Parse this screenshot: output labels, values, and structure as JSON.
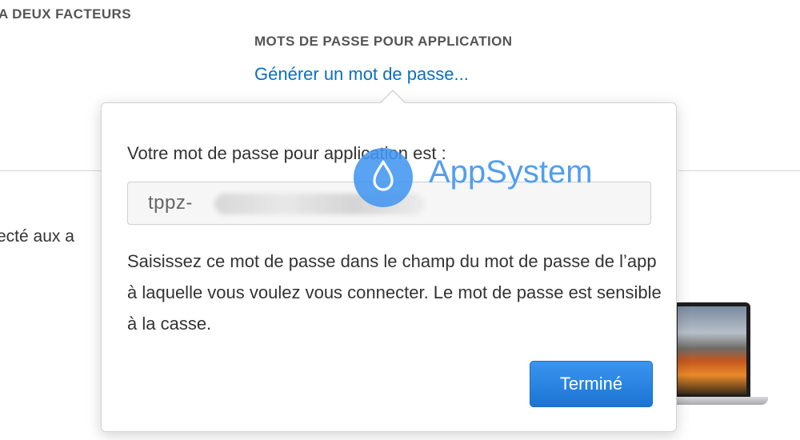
{
  "header": {
    "two_factor_title": "A DEUX FACTEURS",
    "app_passwords_title": "MOTS DE PASSE POUR APPLICATION",
    "generate_link": "Générer un mot de passe..."
  },
  "background": {
    "partial_text": "ecté aux a"
  },
  "popover": {
    "label": "Votre mot de passe pour application est :",
    "password_visible_prefix": "tppz-",
    "instructions": "Saisissez ce mot de passe dans le champ du mot de passe de l’app à laquelle vous voulez vous connecter. Le mot de passe est sensible à la casse.",
    "done_button": "Terminé"
  },
  "watermark": {
    "text": "AppSystem",
    "icon": "water-drop-icon"
  },
  "colors": {
    "link": "#0a6fc2",
    "button": "#1b74d4",
    "watermark": "#4296f0"
  }
}
